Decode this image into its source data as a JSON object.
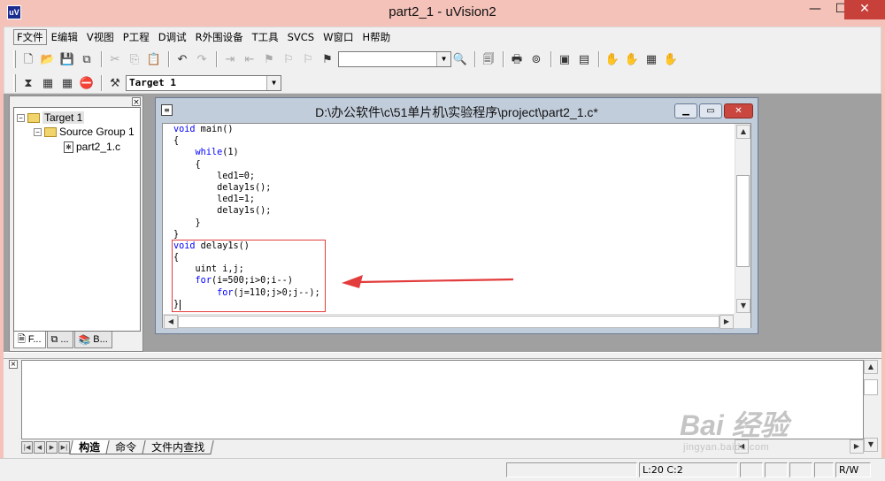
{
  "window": {
    "title": "part2_1  - uVision2",
    "app_icon": "uv2-app-icon",
    "controls": {
      "minimize": "—",
      "maximize": "☐",
      "close": "✕"
    }
  },
  "menu": [
    "F文件",
    "E编辑",
    "V视图",
    "P工程",
    "D调试",
    "R外围设备",
    "T工具",
    "SVCS",
    "W窗口",
    "H帮助"
  ],
  "toolbar1": {
    "find_value": ""
  },
  "toolbar2": {
    "target_value": "Target 1"
  },
  "project_panel": {
    "tree": {
      "target": "Target 1",
      "group": "Source Group 1",
      "file": "part2_1.c",
      "target_toggle": "−",
      "group_toggle": "−"
    },
    "tabs": [
      "F...",
      "...",
      "B..."
    ]
  },
  "editor": {
    "title": "D:\\办公软件\\c\\51单片机\\实验程序\\project\\part2_1.c*",
    "code": [
      [
        [
          "kw",
          "void"
        ],
        [
          "",
          " main()"
        ]
      ],
      [
        [
          "",
          "{"
        ]
      ],
      [
        [
          "",
          "    "
        ],
        [
          "kw",
          "while"
        ],
        [
          "",
          "(1)"
        ]
      ],
      [
        [
          "",
          "    {"
        ]
      ],
      [
        [
          "",
          "        led1=0;"
        ]
      ],
      [
        [
          "",
          "        delay1s();"
        ]
      ],
      [
        [
          "",
          "        led1=1;"
        ]
      ],
      [
        [
          "",
          "        delay1s();"
        ]
      ],
      [
        [
          "",
          "    }"
        ]
      ],
      [
        [
          "",
          "}"
        ]
      ],
      [
        [
          "kw",
          "void"
        ],
        [
          "",
          " delay1s()"
        ]
      ],
      [
        [
          "",
          "{"
        ]
      ],
      [
        [
          "",
          "    uint i,j;"
        ]
      ],
      [
        [
          "",
          "    "
        ],
        [
          "kw",
          "for"
        ],
        [
          "",
          "(i=500;i>0;i--)"
        ]
      ],
      [
        [
          "",
          "        "
        ],
        [
          "kw",
          "for"
        ],
        [
          "",
          "(j=110;j>0;j--);"
        ]
      ],
      [
        [
          "",
          "}"
        ]
      ]
    ],
    "highlight_color": "#e23c3c"
  },
  "output": {
    "tabs": [
      "构造",
      "命令",
      "文件内查找"
    ],
    "active_tab": "构造"
  },
  "status_bar": {
    "position": "L:20 C:2",
    "mode": "R/W"
  },
  "watermark": {
    "logo": "Bai 经验",
    "url": "jingyan.baidu.com"
  },
  "colors": {
    "window_frame": "#f4c2b9",
    "close_red": "#c7413a",
    "keyword_blue": "#0000ff",
    "annotation_red": "#e23c3c"
  }
}
